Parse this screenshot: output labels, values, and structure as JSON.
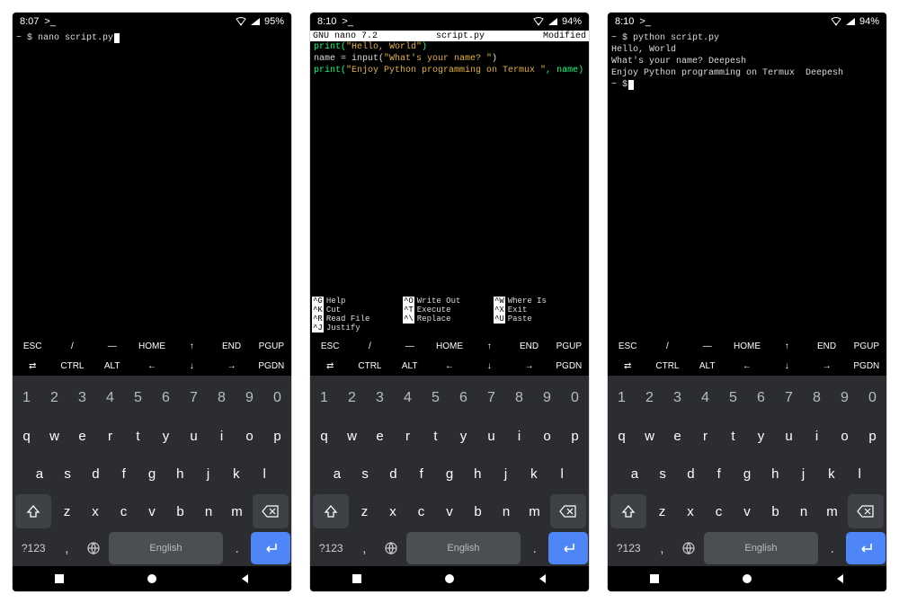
{
  "screens": [
    {
      "status": {
        "time": "8:07",
        "battery": "95%"
      },
      "terminal": {
        "line": "~ $ nano script.py"
      }
    },
    {
      "status": {
        "time": "8:10",
        "battery": "94%"
      },
      "nano": {
        "left": "GNU nano 7.2",
        "center": "script.py",
        "right": "Modified",
        "code1a": "print(",
        "code1b": "\"Hello, World\"",
        "code1c": ")",
        "code2a": "name = input(",
        "code2b": "\"What's your name? \"",
        "code2c": ")",
        "code3a": "print(",
        "code3b": "\"Enjoy Python programming on Termux \"",
        "code3c": ", name)",
        "foot": [
          {
            "k": "^G",
            "l": "Help"
          },
          {
            "k": "^O",
            "l": "Write Out"
          },
          {
            "k": "^W",
            "l": "Where Is"
          },
          {
            "k": "^K",
            "l": "Cut"
          },
          {
            "k": "^T",
            "l": "Execute"
          },
          {
            "k": "^X",
            "l": "Exit"
          },
          {
            "k": "^R",
            "l": "Read File"
          },
          {
            "k": "^\\",
            "l": "Replace"
          },
          {
            "k": "^U",
            "l": "Paste"
          },
          {
            "k": "^J",
            "l": "Justify"
          }
        ]
      }
    },
    {
      "status": {
        "time": "8:10",
        "battery": "94%"
      },
      "output": {
        "l1": "~ $ python script.py",
        "l2": "Hello, World",
        "l3": "What's your name? Deepesh",
        "l4": "Enjoy Python programming on Termux  Deepesh",
        "l5": "~ $"
      }
    }
  ],
  "extrakeys": {
    "r1": [
      "ESC",
      "/",
      "—",
      "HOME",
      "↑",
      "END",
      "PGUP"
    ],
    "r2": [
      "⇄",
      "CTRL",
      "ALT",
      "←",
      "↓",
      "→",
      "PGDN"
    ]
  },
  "keyboard": {
    "nums": [
      "1",
      "2",
      "3",
      "4",
      "5",
      "6",
      "7",
      "8",
      "9",
      "0"
    ],
    "r1": [
      "q",
      "w",
      "e",
      "r",
      "t",
      "y",
      "u",
      "i",
      "o",
      "p"
    ],
    "r2": [
      "a",
      "s",
      "d",
      "f",
      "g",
      "h",
      "j",
      "k",
      "l"
    ],
    "r3": [
      "z",
      "x",
      "c",
      "v",
      "b",
      "n",
      "m"
    ],
    "sym": "?123",
    "space": "English",
    "comma": ",",
    "dot": "."
  }
}
